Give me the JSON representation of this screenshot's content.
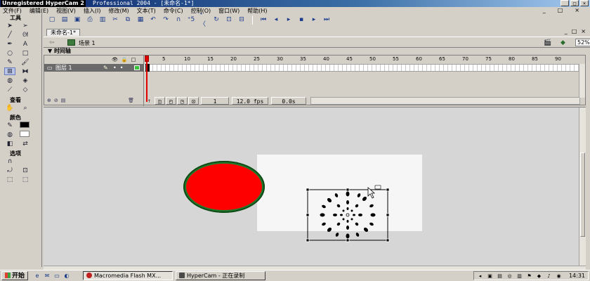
{
  "window": {
    "app_label": "Unregistered HyperCam 2",
    "title": "Professional 2004 - [未命名-1*]",
    "buttons": [
      "_",
      "□",
      "×"
    ]
  },
  "menu": {
    "items": [
      "文件(F)",
      "编辑(E)",
      "视图(V)",
      "插入(I)",
      "修改(M)",
      "文本(T)",
      "命令(C)",
      "控制(O)",
      "窗口(W)",
      "帮助(H)"
    ],
    "mdi_buttons": [
      "_",
      "□",
      "×"
    ]
  },
  "tools_panel": {
    "title": "工具",
    "view_title": "查看",
    "colors_title": "颜色",
    "options_title": "选项",
    "colors": {
      "stroke": "#000000",
      "fill": "#ffffff"
    }
  },
  "document": {
    "tab_label": "未命名-1*",
    "scene_label": "场景 1",
    "zoom_value": "52%",
    "timeline_title": "时间轴",
    "layer_name": "图层 1",
    "ruler_ticks": [
      "1",
      "5",
      "10",
      "15",
      "20",
      "25",
      "30",
      "35",
      "40",
      "45",
      "50",
      "55",
      "60",
      "65",
      "70",
      "75",
      "80",
      "85",
      "90"
    ],
    "current_frame": "1",
    "fps": "12.0 fps",
    "elapsed": "0.0s"
  },
  "stage": {
    "background": "#f6f6f6",
    "circle_fill": "#ff0000",
    "circle_stroke": "#207a2c"
  },
  "taskbar": {
    "start_label": "开始",
    "tasks": [
      {
        "label": "Macromedia Flash MX...",
        "active": true
      },
      {
        "label": "HyperCam - 正在录制",
        "active": false
      }
    ],
    "clock": "14:31"
  }
}
